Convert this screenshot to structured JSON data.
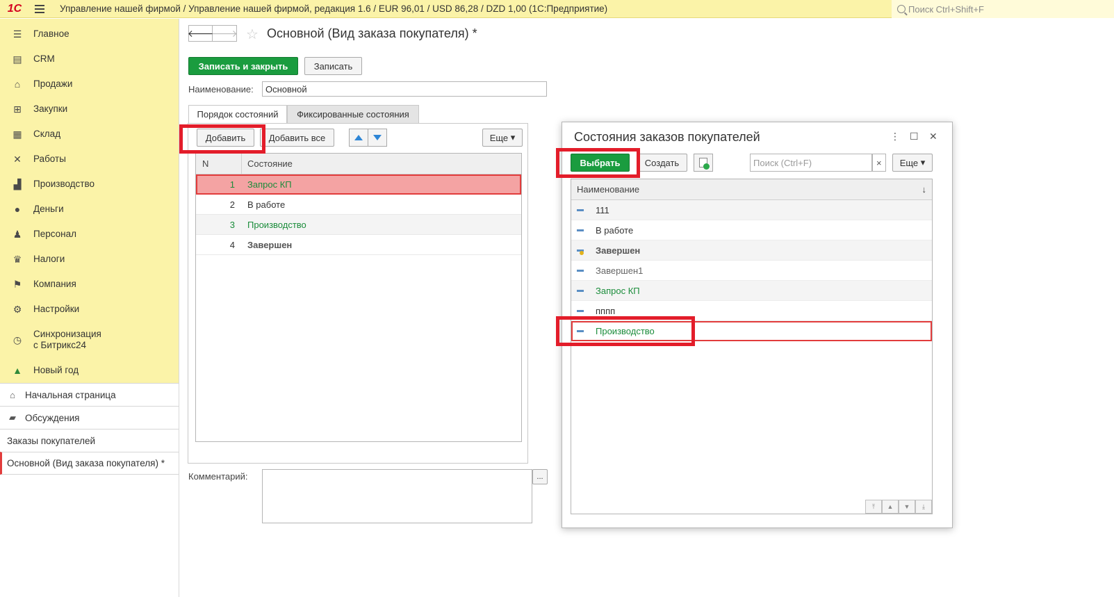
{
  "topbar": {
    "logo": "1С",
    "title": "Управление нашей фирмой / Управление нашей фирмой, редакция 1.6 / EUR 96,01 / USD 86,28 / DZD 1,00  (1С:Предприятие)",
    "search_placeholder": "Поиск Ctrl+Shift+F"
  },
  "sidebar": {
    "nav": [
      {
        "label": "Главное",
        "icon": "menu-lines-icon"
      },
      {
        "label": "CRM",
        "icon": "crm-card-icon"
      },
      {
        "label": "Продажи",
        "icon": "basket-icon"
      },
      {
        "label": "Закупки",
        "icon": "cart-icon"
      },
      {
        "label": "Склад",
        "icon": "warehouse-grid-icon"
      },
      {
        "label": "Работы",
        "icon": "tools-icon"
      },
      {
        "label": "Производство",
        "icon": "factory-icon"
      },
      {
        "label": "Деньги",
        "icon": "money-coin-icon"
      },
      {
        "label": "Персонал",
        "icon": "people-icon"
      },
      {
        "label": "Налоги",
        "icon": "emblem-icon"
      },
      {
        "label": "Компания",
        "icon": "flag-icon"
      },
      {
        "label": "Настройки",
        "icon": "gear-icon"
      },
      {
        "label": "Синхронизация",
        "label2": "с Битрикс24",
        "icon": "sync-icon"
      },
      {
        "label": "Новый год",
        "icon": "tree-icon"
      }
    ],
    "sections": [
      {
        "label": "Начальная страница",
        "icon": "home-icon"
      },
      {
        "label": "Обсуждения",
        "icon": "chat-icon"
      },
      {
        "label": "Заказы покупателей"
      },
      {
        "label": "Основной (Вид заказа покупателя) *"
      }
    ]
  },
  "form": {
    "title": "Основной (Вид заказа покупателя) *",
    "save_close_label": "Записать и закрыть",
    "save_label": "Записать",
    "name_label": "Наименование:",
    "name_value": "Основной",
    "tabs": [
      "Порядок состояний",
      "Фиксированные состояния"
    ],
    "add_label": "Добавить",
    "add_all_label": "Добавить все",
    "more_label": "Еще",
    "grid_headers": {
      "n": "N",
      "state": "Состояние"
    },
    "rows": [
      {
        "n": "1",
        "state": "Запрос КП"
      },
      {
        "n": "2",
        "state": "В работе"
      },
      {
        "n": "3",
        "state": "Производство"
      },
      {
        "n": "4",
        "state": "Завершен"
      }
    ],
    "comment_label": "Комментарий:",
    "comment_btn": "..."
  },
  "popup": {
    "title": "Состояния заказов покупателей",
    "select_label": "Выбрать",
    "create_label": "Создать",
    "search_placeholder": "Поиск (Ctrl+F)",
    "clear": "×",
    "more_label": "Еще",
    "header": "Наименование",
    "sort_indicator": "↓",
    "items": [
      "111",
      "В работе",
      "Завершен",
      "Завершен1",
      "Запрос КП",
      "пппп",
      "Производство"
    ]
  }
}
